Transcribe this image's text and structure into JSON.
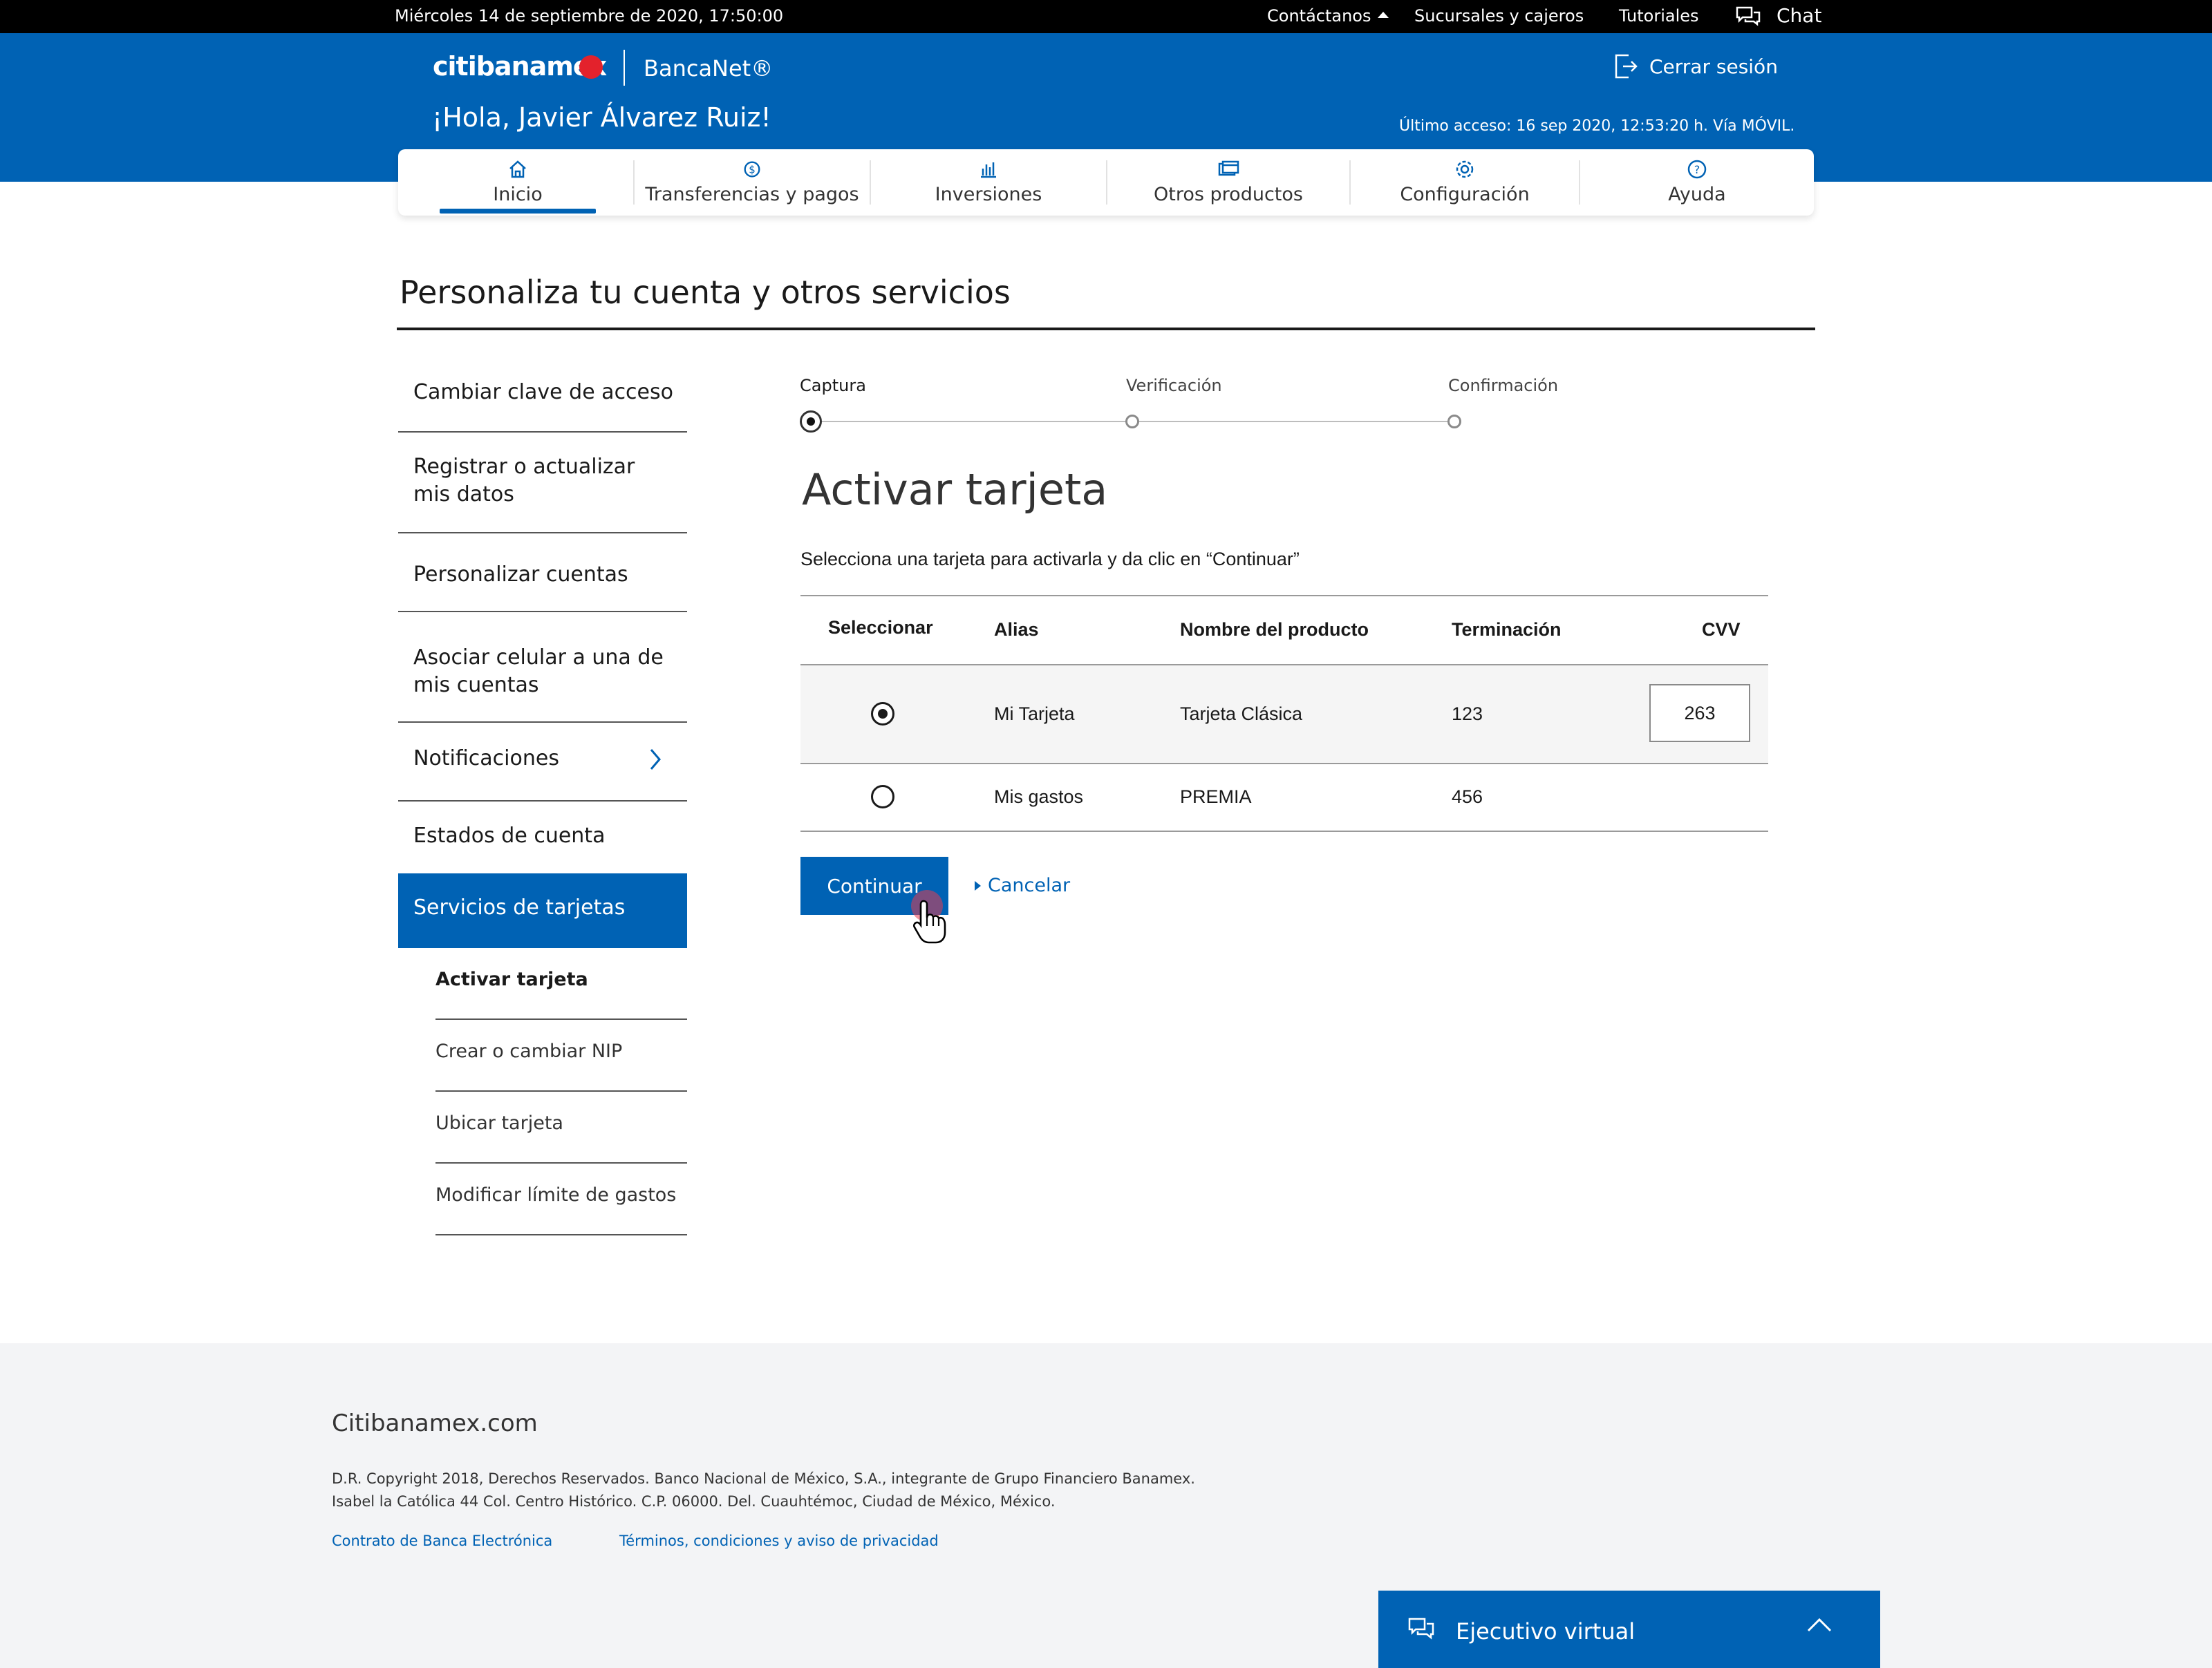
{
  "topbar": {
    "date": "Miércoles 14 de septiembre de 2020, 17:50:00",
    "links": [
      "Contáctanos",
      "Sucursales y cajeros",
      "Tutoriales"
    ],
    "chat": "Chat"
  },
  "header": {
    "logo": "citibanamex",
    "product": "BancaNet®",
    "greeting": "¡Hola, Javier Álvarez Ruiz!",
    "logout": "Cerrar sesión",
    "last_access": "Último acceso: 16 sep 2020, 12:53:20 h. Vía MÓVIL."
  },
  "nav": {
    "items": [
      "Inicio",
      "Transferencias y pagos",
      "Inversiones",
      "Otros productos",
      "Configuración",
      "Ayuda"
    ],
    "active": "Inicio"
  },
  "page": {
    "title": "Personaliza tu cuenta y otros servicios"
  },
  "sidebar": {
    "items": [
      "Cambiar clave de acceso",
      "Registrar o actualizar mis datos",
      "Personalizar cuentas",
      "Asociar celular a una de mis cuentas",
      "Notificaciones",
      "Estados de cuenta",
      "Servicios de tarjetas"
    ],
    "active": "Servicios de tarjetas",
    "subitems": [
      "Activar tarjeta",
      "Crear o cambiar NIP",
      "Ubicar tarjeta",
      "Modificar límite de gastos"
    ],
    "active_sub": "Activar tarjeta"
  },
  "stepper": {
    "steps": [
      "Captura",
      "Verificación",
      "Confirmación"
    ],
    "current": "Captura"
  },
  "main": {
    "heading": "Activar tarjeta",
    "instruction": "Selecciona una tarjeta para activarla y da clic en “Continuar”"
  },
  "table": {
    "headers": [
      "Seleccionar",
      "Alias",
      "Nombre del producto",
      "Terminación",
      "CVV"
    ],
    "rows": [
      {
        "selected": true,
        "alias": "Mi Tarjeta",
        "product": "Tarjeta Clásica",
        "ending": "123",
        "cvv": "263"
      },
      {
        "selected": false,
        "alias": "Mis gastos",
        "product": "PREMIA",
        "ending": "456",
        "cvv": ""
      }
    ]
  },
  "actions": {
    "continue": "Continuar",
    "cancel": "Cancelar"
  },
  "footer": {
    "site": "Citibanamex.com",
    "copyright_1": "D.R. Copyright 2018, Derechos Reservados. Banco Nacional de México, S.A., integrante de Grupo Financiero Banamex.",
    "copyright_2": "Isabel la Católica 44 Col. Centro Histórico. C.P. 06000. Del. Cuauhtémoc, Ciudad de México, México.",
    "links": [
      "Contrato de Banca Electrónica",
      "Términos, condiciones y aviso de privacidad"
    ]
  },
  "virtual_agent": {
    "label": "Ejecutivo virtual"
  },
  "colors": {
    "brand_blue": "#0062b4",
    "brand_red": "#e3222c",
    "topbar_black": "#000000"
  }
}
